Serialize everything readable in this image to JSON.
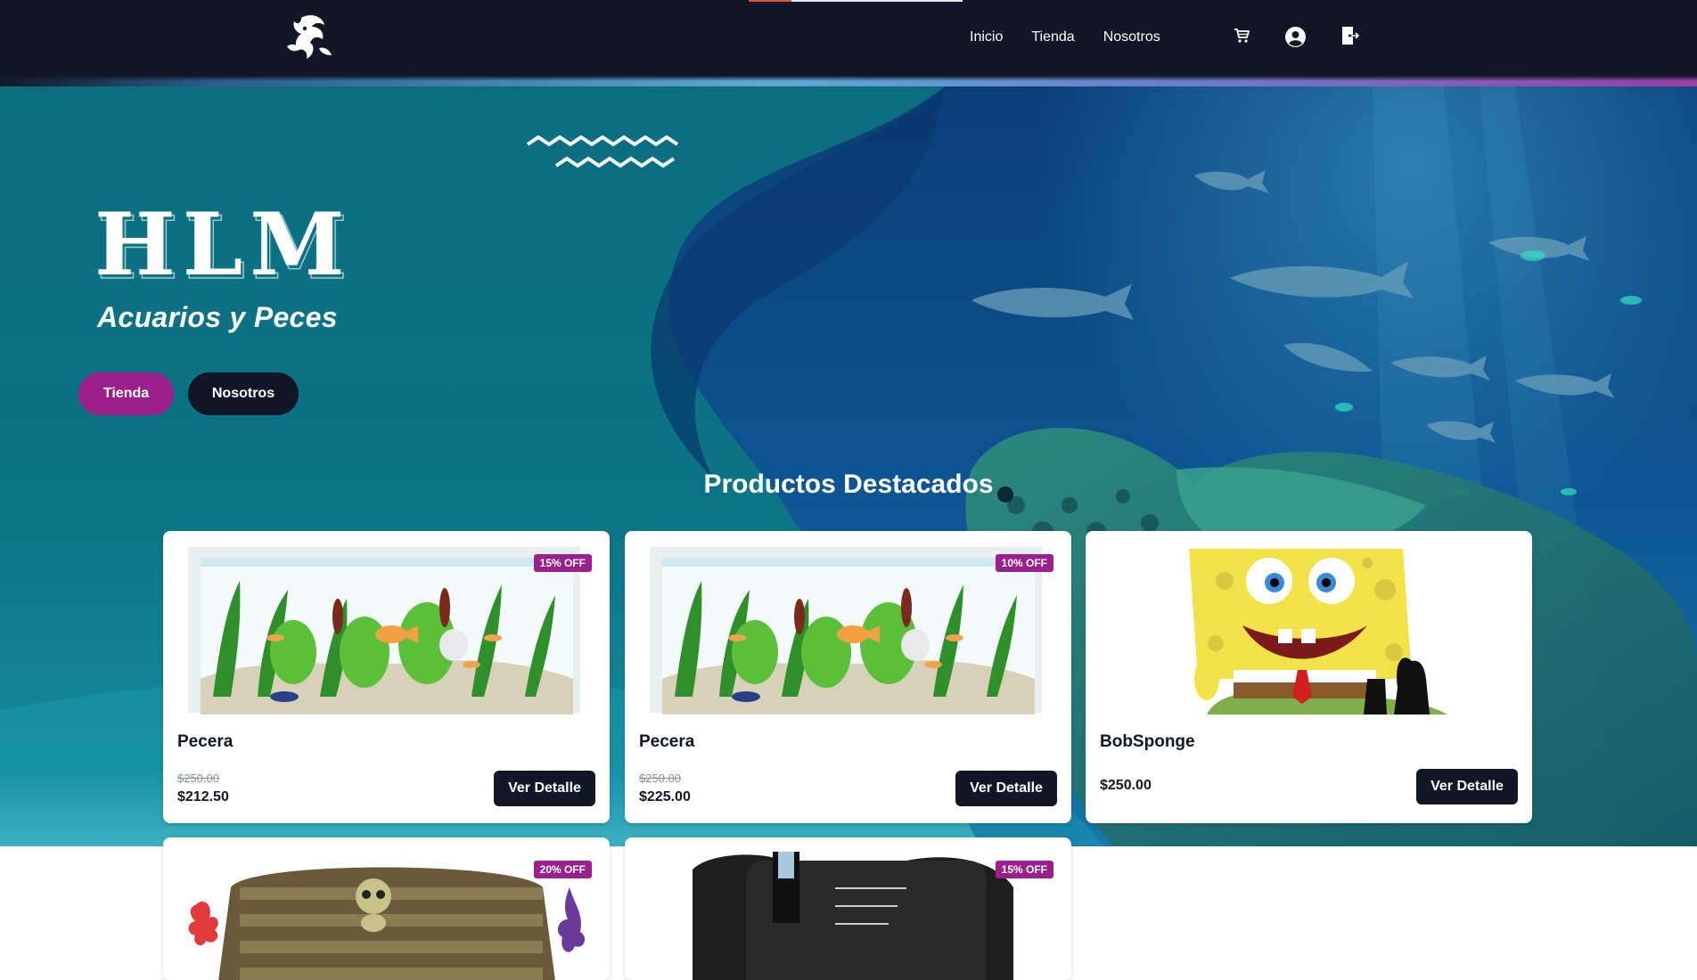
{
  "nav": {
    "links": [
      "Inicio",
      "Tienda",
      "Nosotros"
    ],
    "icons": [
      "cart-icon",
      "user-icon",
      "logout-icon"
    ]
  },
  "hero": {
    "brand_title": "HLM",
    "brand_subtitle": "Acuarios y Peces",
    "buttons": {
      "tienda": "Tienda",
      "nosotros": "Nosotros"
    },
    "section_title": "Productos Destacados"
  },
  "products": [
    {
      "name": "Pecera",
      "badge": "15% OFF",
      "old_price": "$250.00",
      "price": "$212.50",
      "button": "Ver Detalle"
    },
    {
      "name": "Pecera",
      "badge": "10% OFF",
      "old_price": "$250.00",
      "price": "$225.00",
      "button": "Ver Detalle"
    },
    {
      "name": "BobSponge",
      "badge": "",
      "old_price": "",
      "price": "$250.00",
      "button": "Ver Detalle"
    },
    {
      "name": "",
      "badge": "20% OFF",
      "old_price": "",
      "price": "",
      "button": ""
    },
    {
      "name": "",
      "badge": "15% OFF",
      "old_price": "",
      "price": "",
      "button": ""
    }
  ],
  "colors": {
    "navbar": "#111727",
    "accent": "#9b1f8c",
    "hero_teal": "#0b7486",
    "ocean_blue": "#0d4b86"
  }
}
